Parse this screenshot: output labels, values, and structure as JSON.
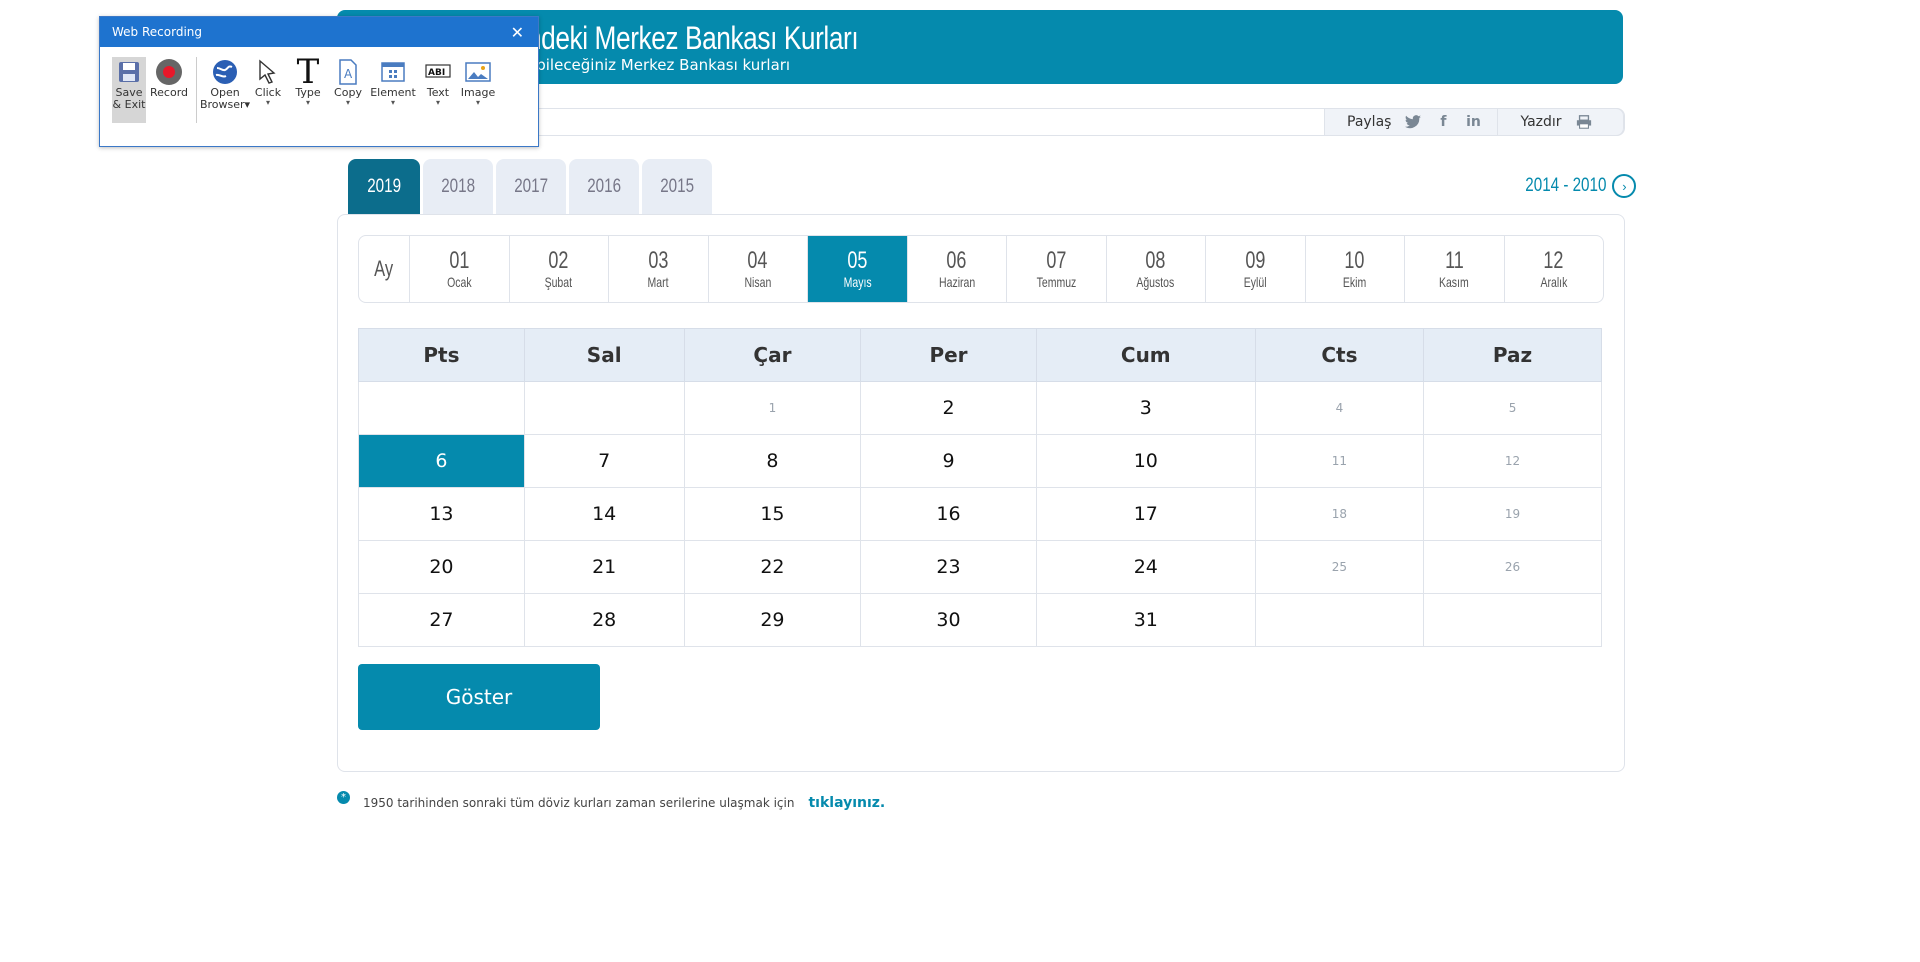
{
  "banner": {
    "title": "ndeki Merkez Bankası Kurları",
    "subtitle": "ebileceğiniz Merkez Bankası kurları"
  },
  "share": {
    "share_label": "Paylaş",
    "print_label": "Yazdır",
    "icons": [
      "twitter-icon",
      "facebook-icon",
      "linkedin-icon",
      "printer-icon"
    ]
  },
  "years": {
    "tabs": [
      "2019",
      "2018",
      "2017",
      "2016",
      "2015"
    ],
    "active": "2019",
    "range_link": "2014 - 2010"
  },
  "months": {
    "header": "Ay",
    "items": [
      {
        "num": "01",
        "name": "Ocak"
      },
      {
        "num": "02",
        "name": "Şubat"
      },
      {
        "num": "03",
        "name": "Mart"
      },
      {
        "num": "04",
        "name": "Nisan"
      },
      {
        "num": "05",
        "name": "Mayıs"
      },
      {
        "num": "06",
        "name": "Haziran"
      },
      {
        "num": "07",
        "name": "Temmuz"
      },
      {
        "num": "08",
        "name": "Ağustos"
      },
      {
        "num": "09",
        "name": "Eylül"
      },
      {
        "num": "10",
        "name": "Ekim"
      },
      {
        "num": "11",
        "name": "Kasım"
      },
      {
        "num": "12",
        "name": "Aralık"
      }
    ],
    "active": "05"
  },
  "calendar": {
    "weekdays": [
      "Pts",
      "Sal",
      "Çar",
      "Per",
      "Cum",
      "Cts",
      "Paz"
    ],
    "weeks": [
      [
        "",
        "",
        "1",
        "2",
        "3",
        "4",
        "5"
      ],
      [
        "6",
        "7",
        "8",
        "9",
        "10",
        "11",
        "12"
      ],
      [
        "13",
        "14",
        "15",
        "16",
        "17",
        "18",
        "19"
      ],
      [
        "20",
        "21",
        "22",
        "23",
        "24",
        "25",
        "26"
      ],
      [
        "27",
        "28",
        "29",
        "30",
        "31",
        "",
        ""
      ]
    ],
    "disabled": [
      "1",
      "4",
      "5",
      "11",
      "12",
      "18",
      "19",
      "25",
      "26"
    ],
    "selected": "6"
  },
  "show_button": "Göster",
  "note": {
    "text": "1950 tarihinden sonraki tüm döviz kurları zaman serilerine ulaşmak için",
    "link": "tıklayınız."
  },
  "recorder": {
    "title": "Web Recording",
    "tools": [
      {
        "label": "Save\n& Exit",
        "icon": "save-icon"
      },
      {
        "label": "Record",
        "icon": "record-icon"
      },
      {
        "label": "Open\nBrowser",
        "icon": "globe-icon"
      },
      {
        "label": "Click",
        "icon": "cursor-icon"
      },
      {
        "label": "Type",
        "icon": "type-icon"
      },
      {
        "label": "Copy",
        "icon": "copy-icon"
      },
      {
        "label": "Element",
        "icon": "element-icon"
      },
      {
        "label": "Text",
        "icon": "text-icon"
      },
      {
        "label": "Image",
        "icon": "image-icon"
      }
    ]
  },
  "colors": {
    "accent": "#058aad",
    "accent_dark": "#0c6d8c",
    "header_bg": "#e5edf6",
    "recorder_title": "#1e73cf"
  }
}
